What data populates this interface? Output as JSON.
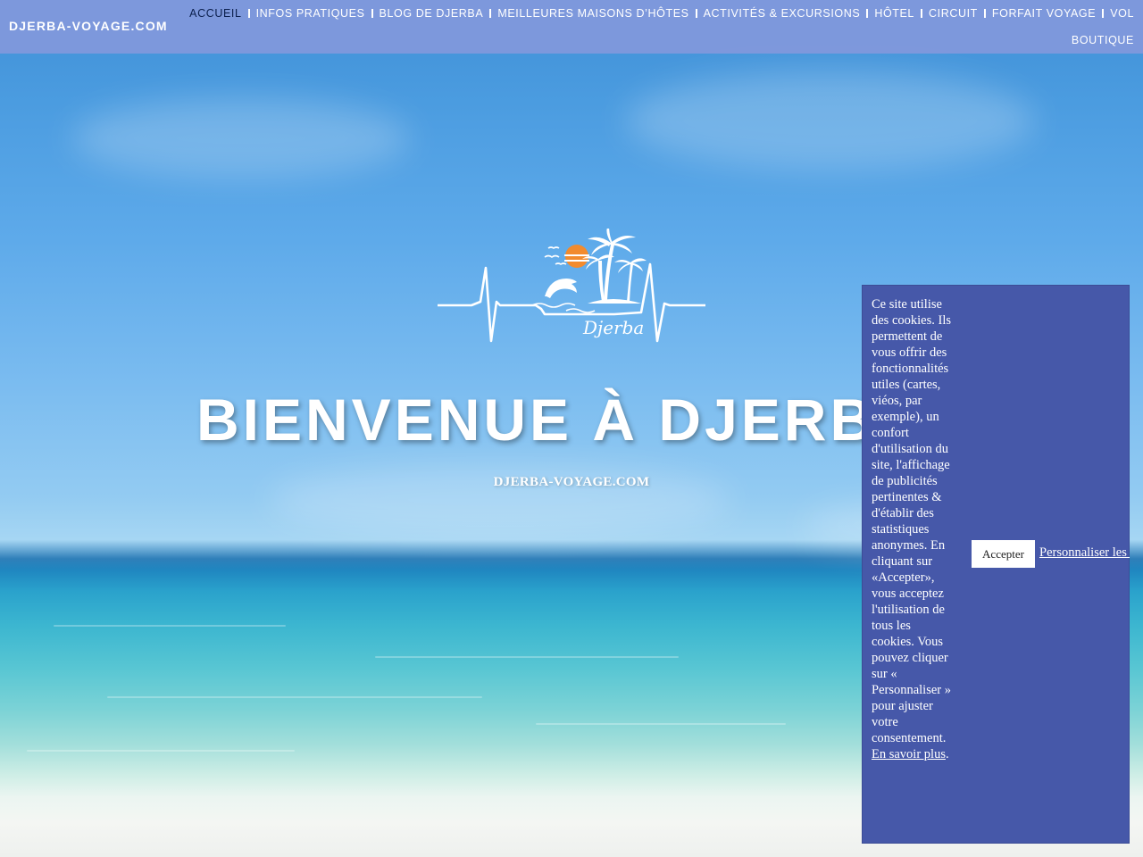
{
  "header": {
    "brand": "DJERBA-VOYAGE.COM",
    "nav_row1": [
      {
        "label": "ACCUEIL",
        "active": true
      },
      {
        "label": "INFOS PRATIQUES"
      },
      {
        "label": "BLOG DE DJERBA"
      },
      {
        "label": "MEILLEURES MAISONS D’HÔTES"
      },
      {
        "label": "ACTIVITÉS & EXCURSIONS"
      },
      {
        "label": "HÔTEL"
      },
      {
        "label": "CIRCUIT"
      },
      {
        "label": "FORFAIT VOYAGE"
      },
      {
        "label": "VOL"
      }
    ],
    "nav_row2": [
      {
        "label": "BOUTIQUE"
      }
    ]
  },
  "hero": {
    "logo_text": "Djerba",
    "title": "BIENVENUE À DJERBA",
    "subtitle": "DJERBA-VOYAGE.COM"
  },
  "cookie": {
    "text": "Ce site utilise des cookies. Ils permettent de vous offrir des fonctionnalités utiles (cartes, viéos, par exemple), un confort d'utilisation du site, l'affichage de publicités pertinentes & d'établir des statistiques anonymes. En cliquant sur «Accepter», vous acceptez l'utilisation de tous les cookies. Vous pouvez cliquer sur « Personnaliser » pour ajuster votre consentement.",
    "learn_more": "En savoir plus",
    "learn_more_suffix": ".",
    "accept_label": "Accepter",
    "personalize_label": "Personnaliser les cookies"
  },
  "colors": {
    "header_bg": "#8098dc",
    "active_nav": "#0b1f4d",
    "cookie_bg": "#4658a9"
  },
  "icons": [
    "sun-icon",
    "palm-trees-icon",
    "dolphin-icon",
    "birds-icon",
    "heartbeat-line-icon"
  ]
}
